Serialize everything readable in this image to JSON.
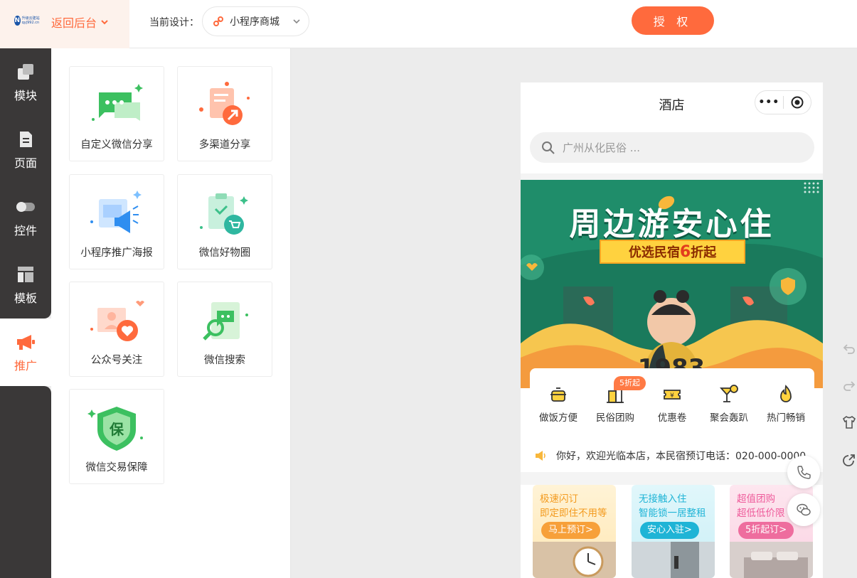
{
  "header": {
    "logo_text": "升级云建站 qyj992.cn",
    "back_label": "返回后台",
    "design_label": "当前设计：",
    "design_value": "小程序商城",
    "auth_label": "授 权"
  },
  "sidebar": {
    "items": [
      {
        "label": "模块",
        "icon": "modules-icon"
      },
      {
        "label": "页面",
        "icon": "page-icon"
      },
      {
        "label": "控件",
        "icon": "toggle-icon"
      },
      {
        "label": "模板",
        "icon": "template-icon"
      },
      {
        "label": "推广",
        "icon": "megaphone-icon"
      }
    ],
    "active_index": 4
  },
  "panel": {
    "cards": [
      {
        "label": "自定义微信分享",
        "icon": "wechat-share-icon"
      },
      {
        "label": "多渠道分享",
        "icon": "multi-share-icon"
      },
      {
        "label": "小程序推广海报",
        "icon": "poster-icon"
      },
      {
        "label": "微信好物圈",
        "icon": "goods-circle-icon"
      },
      {
        "label": "公众号关注",
        "icon": "follow-icon"
      },
      {
        "label": "微信搜索",
        "icon": "wechat-search-icon"
      },
      {
        "label": "微信交易保障",
        "icon": "trade-guarantee-icon"
      }
    ]
  },
  "phone": {
    "title": "酒店",
    "search_placeholder": "广州从化民俗 ...",
    "banner": {
      "title": "周边游安心住",
      "ribbon_pre": "优选民宿",
      "ribbon_num": "6",
      "ribbon_post": "折起",
      "shirt_text": "1983"
    },
    "quick": [
      {
        "label": "做饭方便",
        "icon": "pot-icon"
      },
      {
        "label": "民俗团购",
        "icon": "building-icon"
      },
      {
        "label": "优惠卷",
        "icon": "ticket-icon"
      },
      {
        "label": "聚会轰趴",
        "icon": "cocktail-icon"
      },
      {
        "label": "热门畅销",
        "icon": "fire-icon"
      }
    ],
    "quick_badge": "5折起",
    "notice": "你好，欢迎光临本店，本民宿预订电话：020-000-0000",
    "promos": [
      {
        "line1": "极速闪订",
        "line2": "即定即住不用等",
        "button": "马上预订>"
      },
      {
        "line1": "无接触入住",
        "line2": "智能锁一居整租",
        "button": "安心入驻>"
      },
      {
        "line1": "超值团购",
        "line2": "超低低价限",
        "button": "5折起订>"
      }
    ]
  },
  "floating": [
    {
      "icon": "phone-icon"
    },
    {
      "icon": "wechat-icon"
    }
  ],
  "tools": [
    {
      "icon": "undo-icon"
    },
    {
      "icon": "redo-icon"
    },
    {
      "icon": "tshirt-icon"
    },
    {
      "icon": "share-icon"
    }
  ],
  "colors": {
    "accent": "#ff6a3d",
    "sidebar_bg": "#3a3838",
    "banner_green": "#1f8d6a"
  }
}
